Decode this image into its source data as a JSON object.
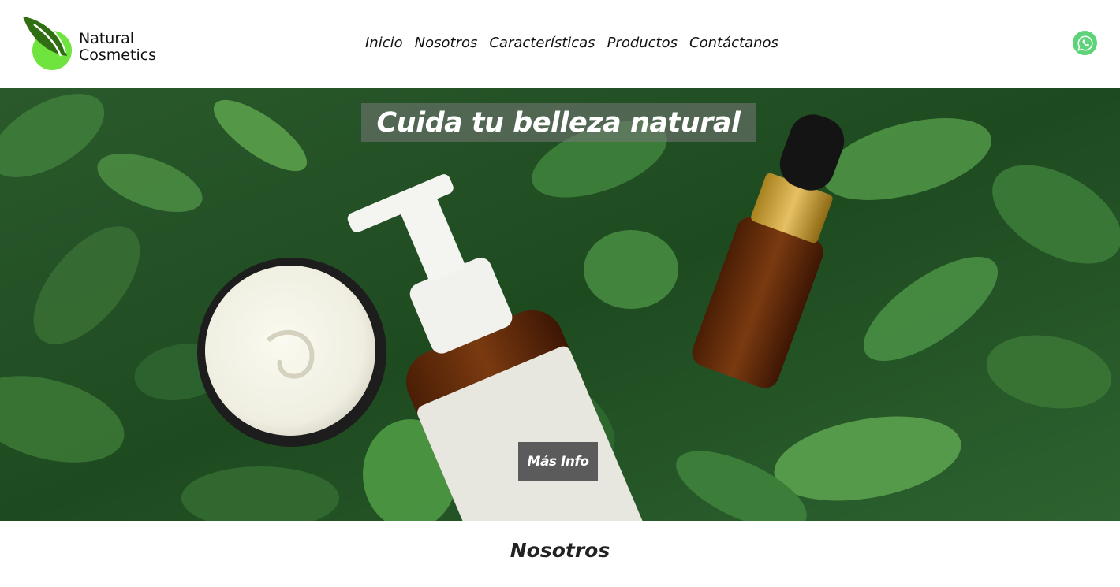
{
  "brand": {
    "name_line1": "Natural",
    "name_line2": "Cosmetics",
    "leaf_color_dark": "#2f6e12",
    "leaf_color_light": "#6fe33e"
  },
  "nav": {
    "items": [
      {
        "label": "Inicio"
      },
      {
        "label": "Nosotros"
      },
      {
        "label": "Características"
      },
      {
        "label": "Productos"
      },
      {
        "label": "Contáctanos"
      }
    ]
  },
  "header": {
    "contact_icon": "whatsapp-icon",
    "contact_icon_color": "#5fd37a"
  },
  "hero": {
    "title": "Cuida tu belleza natural",
    "button_label": "Más Info",
    "image_description_icon": "cosmetics-product-photo"
  },
  "section": {
    "title": "Nosotros"
  }
}
